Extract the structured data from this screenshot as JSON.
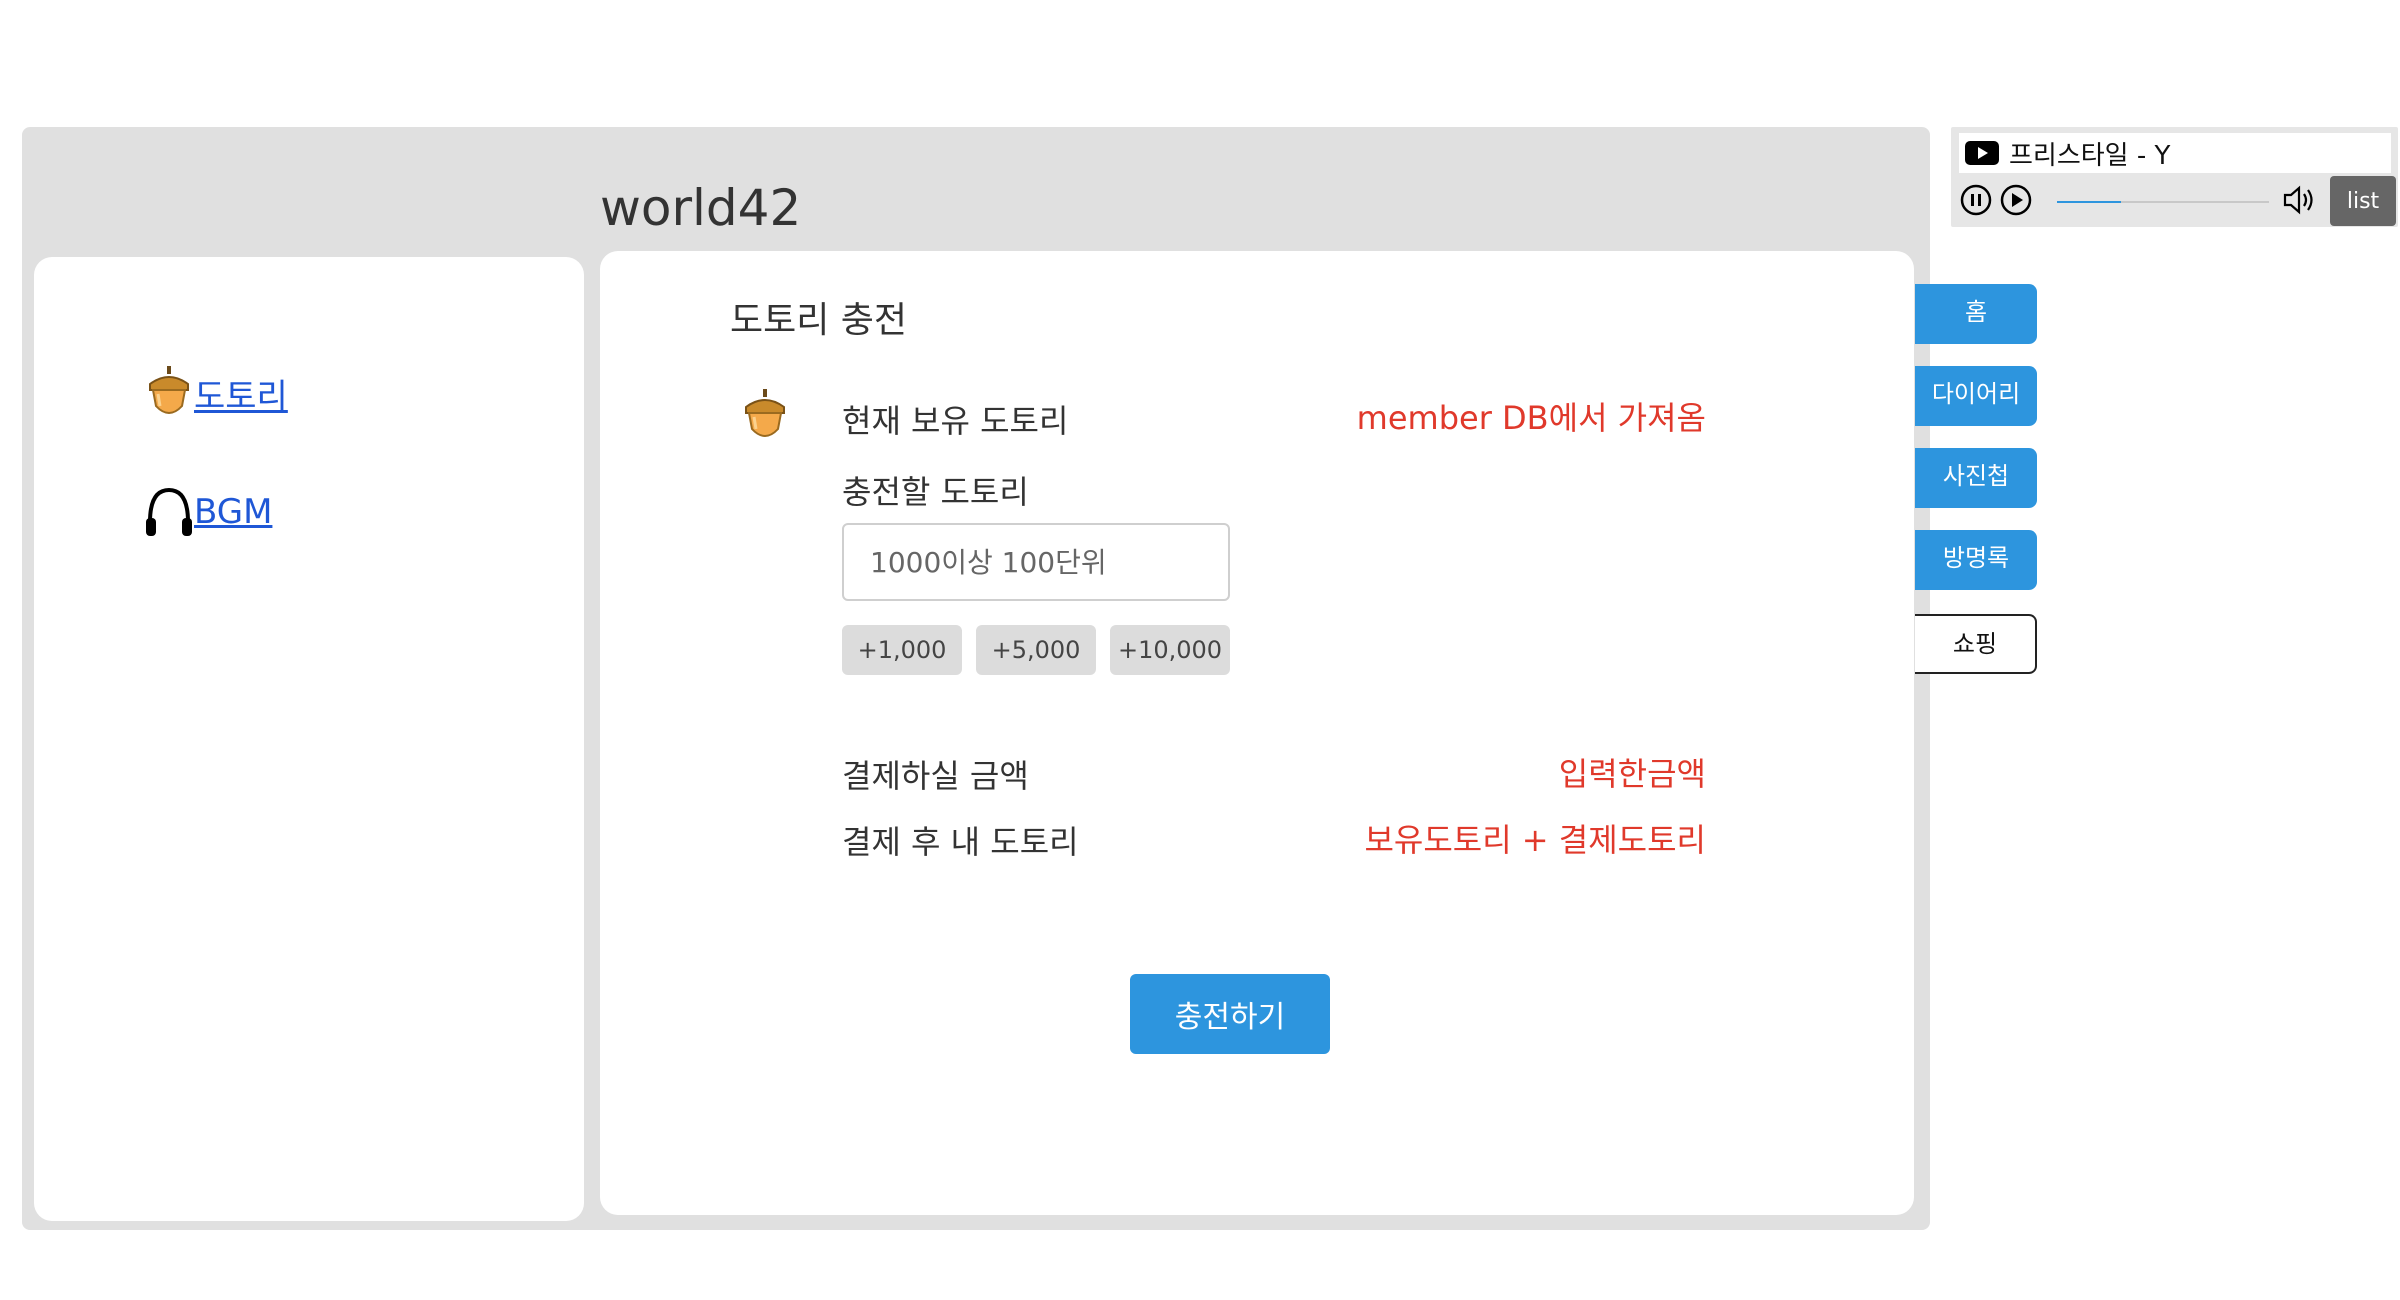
{
  "site": {
    "title": "world42"
  },
  "sidebar": {
    "items": [
      {
        "label": "도토리",
        "icon": "acorn-icon"
      },
      {
        "label": "BGM",
        "icon": "headphones-icon"
      }
    ]
  },
  "charge": {
    "title": "도토리 충전",
    "current_label": "현재 보유 도토리",
    "current_value": "member DB에서 가져옴",
    "amount_label": "충전할 도토리",
    "amount_placeholder": "1000이상 100단위",
    "amount_value": "",
    "quick_buttons": [
      "+1,000",
      "+5,000",
      "+10,000"
    ],
    "pay_label": "결제하실 금액",
    "pay_value": "입력한금액",
    "after_label": "결제 후 내 도토리",
    "after_value": "보유도토리 + 결제도토리",
    "submit_label": "충전하기"
  },
  "nav": {
    "tabs": [
      {
        "label": "홈",
        "active": false
      },
      {
        "label": "다이어리",
        "active": false
      },
      {
        "label": "사진첩",
        "active": false
      },
      {
        "label": "방명록",
        "active": false
      },
      {
        "label": "쇼핑",
        "active": true
      }
    ]
  },
  "player": {
    "title": "프리스타일 - Y",
    "progress_fraction": 0.3,
    "list_label": "list"
  },
  "colors": {
    "accent": "#2d95de",
    "highlight_red": "#e0392b",
    "link": "#1f57d6",
    "frame_bg": "#e0e0e0"
  }
}
